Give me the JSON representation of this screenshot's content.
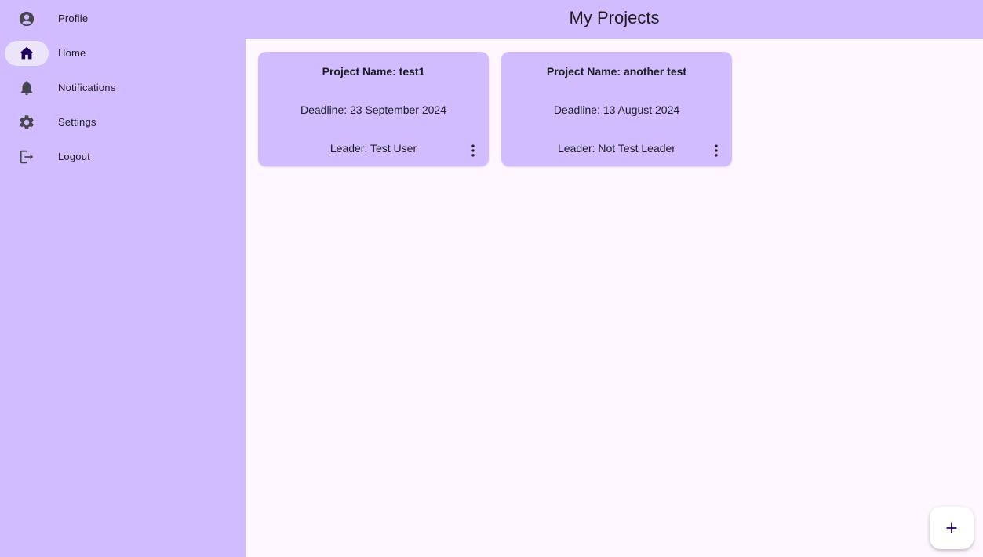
{
  "header": {
    "title": "My Projects"
  },
  "sidebar": {
    "items": [
      {
        "label": "Profile",
        "icon": "account-circle-icon",
        "selected": false
      },
      {
        "label": "Home",
        "icon": "home-icon",
        "selected": true
      },
      {
        "label": "Notifications",
        "icon": "bell-icon",
        "selected": false
      },
      {
        "label": "Settings",
        "icon": "gear-icon",
        "selected": false
      },
      {
        "label": "Logout",
        "icon": "logout-icon",
        "selected": false
      }
    ]
  },
  "projects": [
    {
      "name": "Project Name: test1",
      "deadline": "Deadline: 23 September 2024",
      "leader": "Leader: Test User",
      "menu_icon": "more-vertical-icon"
    },
    {
      "name": "Project Name: another test",
      "deadline": "Deadline: 13 August 2024",
      "leader": "Leader: Not Test Leader",
      "menu_icon": "more-vertical-icon"
    }
  ],
  "fab": {
    "icon": "plus-icon"
  },
  "colors": {
    "surface_accent": "#d0bcff",
    "background": "#fef7ff",
    "selected_indicator": "#ece4f8",
    "text": "#1d1b20",
    "fab_icon": "#21005d"
  }
}
